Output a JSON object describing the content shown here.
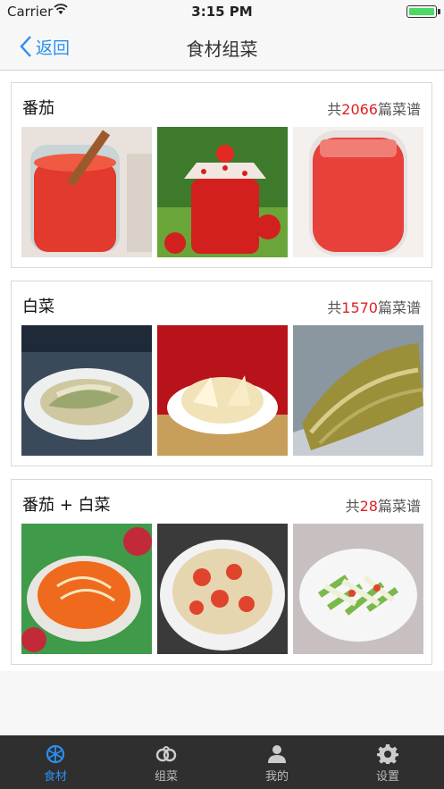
{
  "status_bar": {
    "carrier": "Carrier",
    "time": "3:15 PM"
  },
  "nav": {
    "back_label": "返回",
    "title": "食材组菜"
  },
  "cards": [
    {
      "title": "番茄",
      "count_prefix": "共",
      "count": "2066",
      "count_suffix": "篇菜谱"
    },
    {
      "title": "白菜",
      "count_prefix": "共",
      "count": "1570",
      "count_suffix": "篇菜谱"
    },
    {
      "title": "番茄 + 白菜",
      "count_prefix": "共",
      "count": "28",
      "count_suffix": "篇菜谱"
    }
  ],
  "tabs": [
    {
      "label": "食材",
      "icon": "ingredients-icon",
      "active": true
    },
    {
      "label": "组菜",
      "icon": "combo-icon",
      "active": false
    },
    {
      "label": "我的",
      "icon": "profile-icon",
      "active": false
    },
    {
      "label": "设置",
      "icon": "gear-icon",
      "active": false
    }
  ],
  "colors": {
    "accent": "#2a8ff0",
    "count_highlight": "#e02020",
    "tabbar_bg": "#2f2f2f"
  }
}
